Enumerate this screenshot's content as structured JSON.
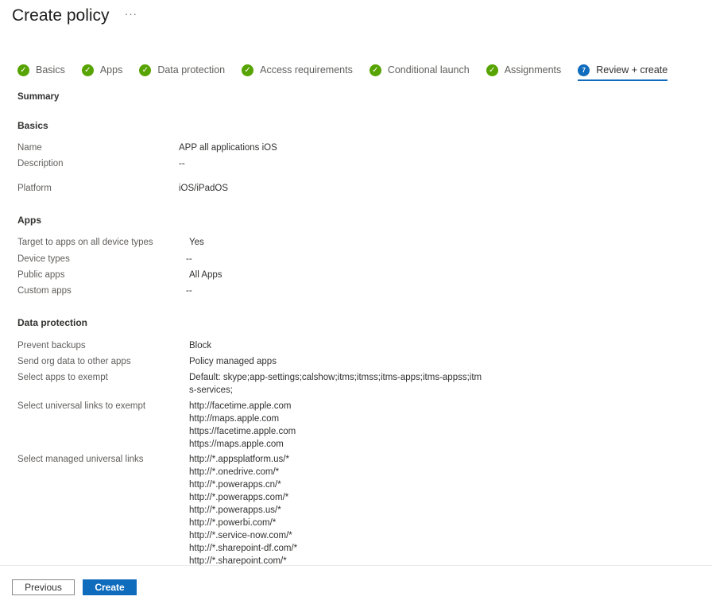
{
  "header": {
    "title": "Create policy",
    "more": "···"
  },
  "steps": [
    {
      "label": "Basics",
      "status": "complete"
    },
    {
      "label": "Apps",
      "status": "complete"
    },
    {
      "label": "Data protection",
      "status": "complete"
    },
    {
      "label": "Access requirements",
      "status": "complete"
    },
    {
      "label": "Conditional launch",
      "status": "complete"
    },
    {
      "label": "Assignments",
      "status": "complete"
    },
    {
      "label": "Review + create",
      "status": "current",
      "number": "7"
    }
  ],
  "summary": "Summary",
  "sections": {
    "basics": {
      "title": "Basics",
      "rows": [
        {
          "label": "Name",
          "value": "APP all applications iOS"
        },
        {
          "label": "Description",
          "value": "--"
        },
        {
          "label": "Platform",
          "value": "iOS/iPadOS"
        }
      ]
    },
    "apps": {
      "title": "Apps",
      "rows": [
        {
          "label": "Target to apps on all device types",
          "value": "Yes"
        },
        {
          "label": "Device types",
          "value": "--"
        },
        {
          "label": "Public apps",
          "value": "All Apps"
        },
        {
          "label": "Custom apps",
          "value": "--"
        }
      ]
    },
    "data_protection": {
      "title": "Data protection",
      "rows": [
        {
          "label": "Prevent backups",
          "value": "Block"
        },
        {
          "label": "Send org data to other apps",
          "value": "Policy managed apps"
        },
        {
          "label": "Select apps to exempt",
          "value": "Default: skype;app-settings;calshow;itms;itmss;itms-apps;itms-appss;itms-services;"
        },
        {
          "label": "Select universal links to exempt",
          "values": [
            "http://facetime.apple.com",
            "http://maps.apple.com",
            "https://facetime.apple.com",
            "https://maps.apple.com"
          ]
        },
        {
          "label": "Select managed universal links",
          "values": [
            "http://*.appsplatform.us/*",
            "http://*.onedrive.com/*",
            "http://*.powerapps.cn/*",
            "http://*.powerapps.com/*",
            "http://*.powerapps.us/*",
            "http://*.powerbi.com/*",
            "http://*.service-now.com/*",
            "http://*.sharepoint-df.com/*",
            "http://*.sharepoint.com/*"
          ]
        }
      ]
    }
  },
  "footer": {
    "previous": "Previous",
    "create": "Create"
  },
  "colors": {
    "accent": "#0f6cbd",
    "complete": "#57a300"
  }
}
